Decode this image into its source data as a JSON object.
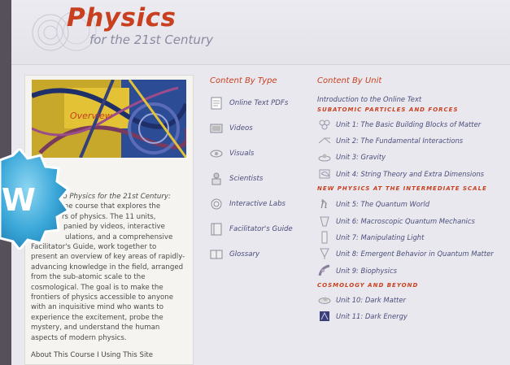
{
  "header": {
    "title": "Physics",
    "subtitle": "for the 21st Century"
  },
  "overview": {
    "title": "Overview",
    "lines": [
      "to Physics for the 21st Century:",
      "line course that explores the",
      "rs of physics. The 11 units,",
      "panied by videos, interactive",
      "ulations, and a comprehensive",
      "Facilitator's Guide, work together to",
      "present an overview of key areas of rapidly-",
      "advancing knowledge in the field, arranged",
      "from the sub-atomic scale to the",
      "cosmological. The goal is to make the",
      "frontiers of physics accessible to anyone",
      "with an inquisitive mind who wants to",
      "experience the excitement, probe the",
      "mystery, and understand the human",
      "aspects of modern physics."
    ],
    "footer_links": "About This Course I Using This Site"
  },
  "badge": {
    "letter": "W"
  },
  "content_by_type": {
    "title": "Content By Type",
    "items": [
      {
        "label": "Online Text PDFs",
        "icon": "document-icon"
      },
      {
        "label": "Videos",
        "icon": "video-icon"
      },
      {
        "label": "Visuals",
        "icon": "visuals-icon"
      },
      {
        "label": "Scientists",
        "icon": "scientist-icon"
      },
      {
        "label": "Interactive Labs",
        "icon": "lab-icon"
      },
      {
        "label": "Facilitator's Guide",
        "icon": "guide-icon"
      },
      {
        "label": "Glossary",
        "icon": "glossary-icon"
      }
    ]
  },
  "content_by_unit": {
    "title": "Content By Unit",
    "intro": "Introduction to the Online Text",
    "sections": [
      {
        "heading": "SUBATOMIC PARTICLES AND FORCES",
        "units": [
          "Unit 1: The Basic Building Blocks of Matter",
          "Unit 2: The Fundamental Interactions",
          "Unit 3: Gravity",
          "Unit 4: String Theory and Extra Dimensions"
        ]
      },
      {
        "heading": "NEW PHYSICS AT THE INTERMEDIATE SCALE",
        "units": [
          "Unit 5: The Quantum World",
          "Unit 6: Macroscopic Quantum Mechanics",
          "Unit 7: Manipulating Light",
          "Unit 8: Emergent Behavior in Quantum Matter",
          "Unit 9: Biophysics"
        ]
      },
      {
        "heading": "COSMOLOGY AND BEYOND",
        "units": [
          "Unit 10: Dark Matter",
          "Unit 11: Dark Energy"
        ]
      }
    ]
  },
  "colors": {
    "accent": "#c8401f",
    "link": "#4b4d7c",
    "badge": "#3aa7d8"
  }
}
